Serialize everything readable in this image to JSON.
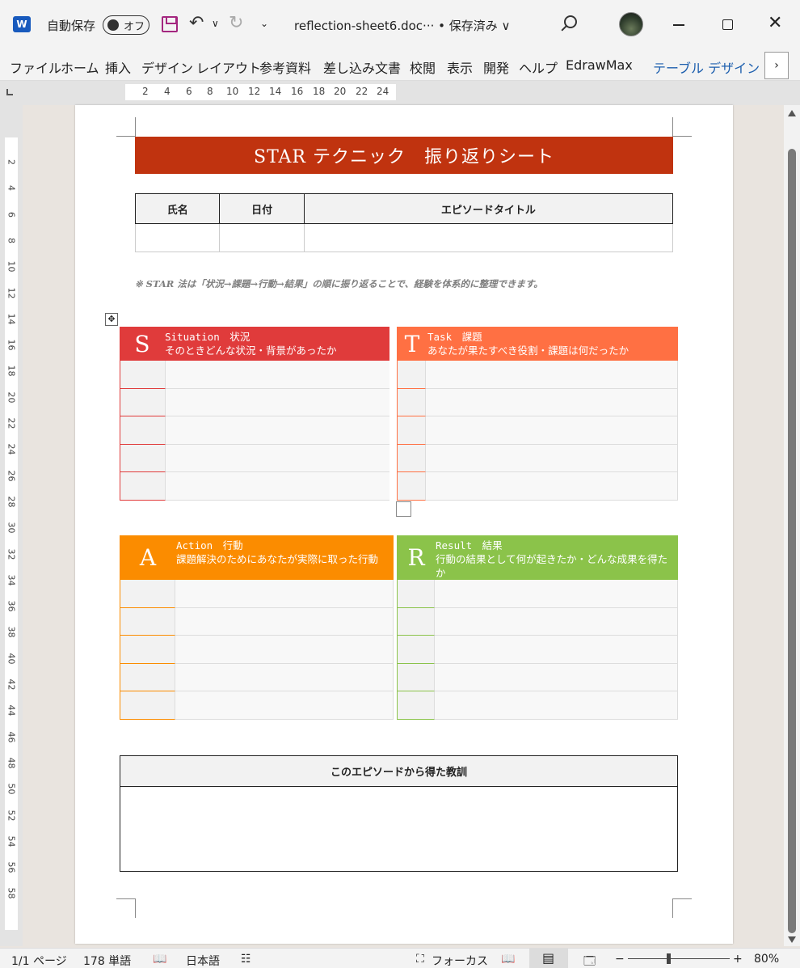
{
  "titlebar": {
    "app_icon": "W",
    "autosave_label": "自動保存",
    "autosave_state": "オフ",
    "doc_name": "reflection-sheet6.doc···  • 保存済み ∨",
    "icons": [
      "save-icon",
      "undo-icon",
      "redo-icon",
      "search-icon",
      "avatar",
      "minimize-icon",
      "maximize-icon",
      "close-icon"
    ]
  },
  "ribbon": {
    "tabs": [
      "ファイル",
      "ホーム",
      "挿入",
      "デザイン",
      "レイアウト",
      "参考資料",
      "差し込み文書",
      "校閲",
      "表示",
      "開発",
      "ヘルプ",
      "EdrawMax",
      "テーブル デザイン"
    ],
    "more": "›"
  },
  "ruler": {
    "h_numbers": [
      "2",
      "4",
      "6",
      "8",
      "10",
      "12",
      "14",
      "16",
      "18",
      "20",
      "22",
      "24"
    ],
    "v_numbers": [
      "2",
      "4",
      "6",
      "8",
      "10",
      "12",
      "14",
      "16",
      "18",
      "20",
      "22",
      "24",
      "26",
      "28",
      "30",
      "32",
      "34",
      "36",
      "38",
      "40",
      "42",
      "44",
      "46",
      "48",
      "50",
      "52",
      "54",
      "56",
      "58"
    ]
  },
  "document": {
    "title": "STAR テクニック　振り返りシート",
    "info_headers": [
      "氏名",
      "日付",
      "エピソードタイトル"
    ],
    "note": "※ STAR 法は「状況→課題→行動→結果」の順に振り返ることで、経験を体系的に整理できます。",
    "sections": {
      "s": {
        "letter": "S",
        "label": "Situation　状況",
        "desc": "そのときどんな状況・背景があったか",
        "color": "#e03b3b"
      },
      "t": {
        "letter": "T",
        "label": "Task　課題",
        "desc": "あなたが果たすべき役割・課題は何だったか",
        "color": "#ff7043"
      },
      "a": {
        "letter": "A",
        "label": "Action　行動",
        "desc": "課題解決のためにあなたが実際に取った行動",
        "color": "#fb8c00"
      },
      "r": {
        "letter": "R",
        "label": "Result　結果",
        "desc": "行動の結果として何が起きたか・どんな成果を得たか",
        "color": "#8bc34a"
      }
    },
    "lesson_header": "このエピソードから得た教訓"
  },
  "statusbar": {
    "page": "1/1 ページ",
    "words": "178 単語",
    "language": "日本語",
    "focus": "フォーカス",
    "zoom": "80%"
  }
}
